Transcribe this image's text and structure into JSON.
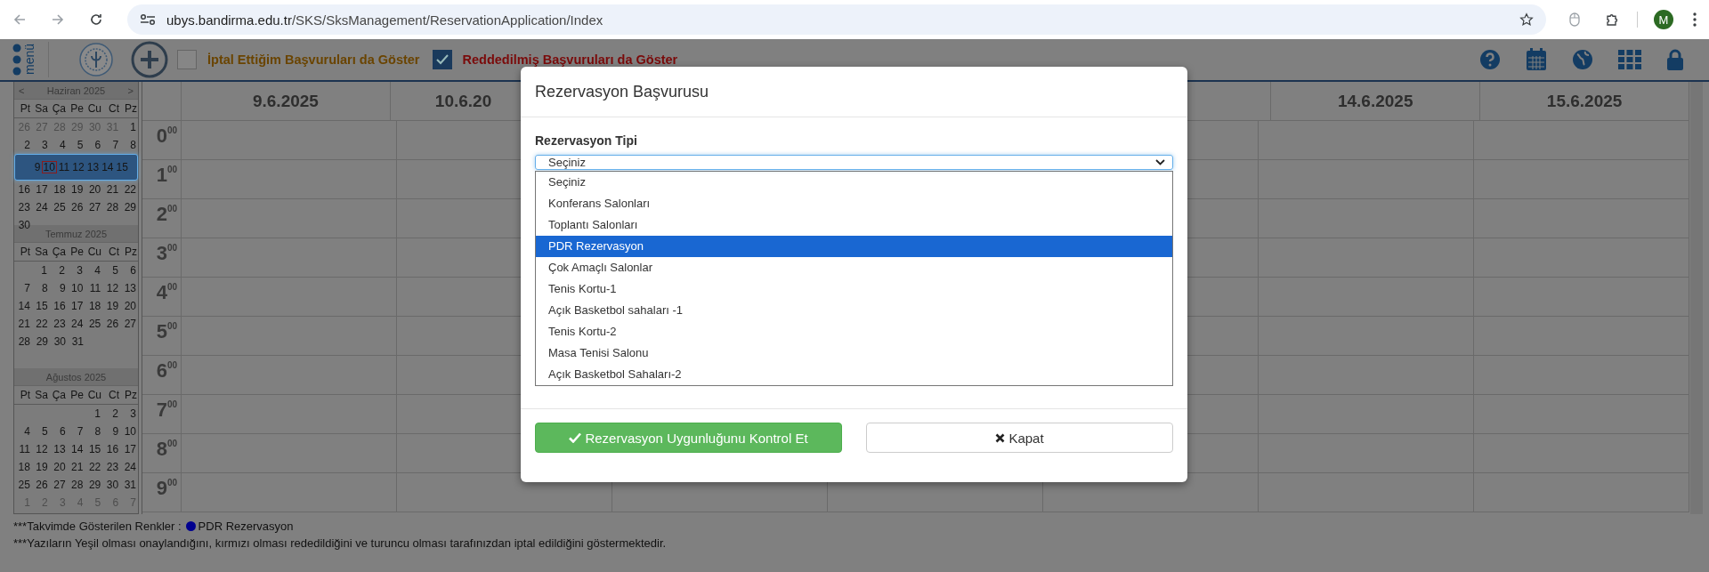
{
  "browser": {
    "url_host": "ubys.bandirma.edu.tr",
    "url_path": "/SKS/SksManagement/ReservationApplication/Index",
    "avatar": "M"
  },
  "toolbar": {
    "menu_label": "menü",
    "filters": [
      {
        "label": "İptal Ettiğim Başvuruları da Göster",
        "checked": false,
        "color": "#6a4400"
      },
      {
        "label": "Reddedilmiş Başvuruları da Göster",
        "checked": true,
        "color": "#7a0a0a"
      }
    ]
  },
  "mini_calendar": {
    "months": [
      {
        "title": "Haziran 2025",
        "prev": "<",
        "next": ">",
        "weekdays": [
          "Pt",
          "Sa",
          "Ça",
          "Pe",
          "Cu",
          "Ct",
          "Pz"
        ],
        "weeks": [
          {
            "kind": "full",
            "selected": false,
            "days": [
              {
                "day": "26",
                "muted": true,
                "today": false
              },
              {
                "day": "27",
                "muted": true,
                "today": false
              },
              {
                "day": "28",
                "muted": true,
                "today": false
              },
              {
                "day": "29",
                "muted": true,
                "today": false
              },
              {
                "day": "30",
                "muted": true,
                "today": false
              },
              {
                "day": "31",
                "muted": true,
                "today": false
              },
              {
                "day": "1",
                "muted": false,
                "today": false
              }
            ]
          },
          {
            "kind": "full",
            "selected": false,
            "days": [
              {
                "day": "2",
                "muted": false,
                "today": false
              },
              {
                "day": "3",
                "muted": false,
                "today": false
              },
              {
                "day": "4",
                "muted": false,
                "today": false
              },
              {
                "day": "5",
                "muted": false,
                "today": false
              },
              {
                "day": "6",
                "muted": false,
                "today": false
              },
              {
                "day": "7",
                "muted": false,
                "today": false
              },
              {
                "day": "8",
                "muted": false,
                "today": false
              }
            ]
          },
          {
            "kind": "full",
            "selected": true,
            "days": [
              {
                "day": "9",
                "muted": false,
                "today": false
              },
              {
                "day": "10",
                "muted": false,
                "today": true
              },
              {
                "day": "11",
                "muted": false,
                "today": false
              },
              {
                "day": "12",
                "muted": false,
                "today": false
              },
              {
                "day": "13",
                "muted": false,
                "today": false
              },
              {
                "day": "14",
                "muted": false,
                "today": false
              },
              {
                "day": "15",
                "muted": false,
                "today": false
              }
            ]
          },
          {
            "kind": "full",
            "selected": false,
            "days": [
              {
                "day": "16",
                "muted": false,
                "today": false
              },
              {
                "day": "17",
                "muted": false,
                "today": false
              },
              {
                "day": "18",
                "muted": false,
                "today": false
              },
              {
                "day": "19",
                "muted": false,
                "today": false
              },
              {
                "day": "20",
                "muted": false,
                "today": false
              },
              {
                "day": "21",
                "muted": false,
                "today": false
              },
              {
                "day": "22",
                "muted": false,
                "today": false
              }
            ]
          },
          {
            "kind": "full",
            "selected": false,
            "days": [
              {
                "day": "23",
                "muted": false,
                "today": false
              },
              {
                "day": "24",
                "muted": false,
                "today": false
              },
              {
                "day": "25",
                "muted": false,
                "today": false
              },
              {
                "day": "26",
                "muted": false,
                "today": false
              },
              {
                "day": "27",
                "muted": false,
                "today": false
              },
              {
                "day": "28",
                "muted": false,
                "today": false
              },
              {
                "day": "29",
                "muted": false,
                "today": false
              }
            ]
          },
          {
            "kind": "leading",
            "selected": false,
            "days": [
              {
                "day": "30",
                "muted": false,
                "today": false
              }
            ]
          }
        ]
      },
      {
        "title": "Temmuz 2025",
        "weekdays": [
          "Pt",
          "Sa",
          "Ça",
          "Pe",
          "Cu",
          "Ct",
          "Pz"
        ],
        "weeks": [
          {
            "kind": "trailing",
            "selected": false,
            "days": [
              {
                "day": "1",
                "muted": false,
                "today": false
              },
              {
                "day": "2",
                "muted": false,
                "today": false
              },
              {
                "day": "3",
                "muted": false,
                "today": false
              },
              {
                "day": "4",
                "muted": false,
                "today": false
              },
              {
                "day": "5",
                "muted": false,
                "today": false
              },
              {
                "day": "6",
                "muted": false,
                "today": false
              }
            ]
          },
          {
            "kind": "full",
            "selected": false,
            "days": [
              {
                "day": "7",
                "muted": false,
                "today": false
              },
              {
                "day": "8",
                "muted": false,
                "today": false
              },
              {
                "day": "9",
                "muted": false,
                "today": false
              },
              {
                "day": "10",
                "muted": false,
                "today": false
              },
              {
                "day": "11",
                "muted": false,
                "today": false
              },
              {
                "day": "12",
                "muted": false,
                "today": false
              },
              {
                "day": "13",
                "muted": false,
                "today": false
              }
            ]
          },
          {
            "kind": "full",
            "selected": false,
            "days": [
              {
                "day": "14",
                "muted": false,
                "today": false
              },
              {
                "day": "15",
                "muted": false,
                "today": false
              },
              {
                "day": "16",
                "muted": false,
                "today": false
              },
              {
                "day": "17",
                "muted": false,
                "today": false
              },
              {
                "day": "18",
                "muted": false,
                "today": false
              },
              {
                "day": "19",
                "muted": false,
                "today": false
              },
              {
                "day": "20",
                "muted": false,
                "today": false
              }
            ]
          },
          {
            "kind": "full",
            "selected": false,
            "days": [
              {
                "day": "21",
                "muted": false,
                "today": false
              },
              {
                "day": "22",
                "muted": false,
                "today": false
              },
              {
                "day": "23",
                "muted": false,
                "today": false
              },
              {
                "day": "24",
                "muted": false,
                "today": false
              },
              {
                "day": "25",
                "muted": false,
                "today": false
              },
              {
                "day": "26",
                "muted": false,
                "today": false
              },
              {
                "day": "27",
                "muted": false,
                "today": false
              }
            ]
          },
          {
            "kind": "leading",
            "selected": false,
            "days": [
              {
                "day": "28",
                "muted": false,
                "today": false
              },
              {
                "day": "29",
                "muted": false,
                "today": false
              },
              {
                "day": "30",
                "muted": false,
                "today": false
              },
              {
                "day": "31",
                "muted": false,
                "today": false
              }
            ]
          }
        ]
      },
      {
        "title": "Ağustos 2025",
        "weekdays": [
          "Pt",
          "Sa",
          "Ça",
          "Pe",
          "Cu",
          "Ct",
          "Pz"
        ],
        "weeks": [
          {
            "kind": "trailing",
            "selected": false,
            "days": [
              {
                "day": "1",
                "muted": false,
                "today": false
              },
              {
                "day": "2",
                "muted": false,
                "today": false
              },
              {
                "day": "3",
                "muted": false,
                "today": false
              }
            ]
          },
          {
            "kind": "full",
            "selected": false,
            "days": [
              {
                "day": "4",
                "muted": false,
                "today": false
              },
              {
                "day": "5",
                "muted": false,
                "today": false
              },
              {
                "day": "6",
                "muted": false,
                "today": false
              },
              {
                "day": "7",
                "muted": false,
                "today": false
              },
              {
                "day": "8",
                "muted": false,
                "today": false
              },
              {
                "day": "9",
                "muted": false,
                "today": false
              },
              {
                "day": "10",
                "muted": false,
                "today": false
              }
            ]
          },
          {
            "kind": "full",
            "selected": false,
            "days": [
              {
                "day": "11",
                "muted": false,
                "today": false
              },
              {
                "day": "12",
                "muted": false,
                "today": false
              },
              {
                "day": "13",
                "muted": false,
                "today": false
              },
              {
                "day": "14",
                "muted": false,
                "today": false
              },
              {
                "day": "15",
                "muted": false,
                "today": false
              },
              {
                "day": "16",
                "muted": false,
                "today": false
              },
              {
                "day": "17",
                "muted": false,
                "today": false
              }
            ]
          },
          {
            "kind": "full",
            "selected": false,
            "days": [
              {
                "day": "18",
                "muted": false,
                "today": false
              },
              {
                "day": "19",
                "muted": false,
                "today": false
              },
              {
                "day": "20",
                "muted": false,
                "today": false
              },
              {
                "day": "21",
                "muted": false,
                "today": false
              },
              {
                "day": "22",
                "muted": false,
                "today": false
              },
              {
                "day": "23",
                "muted": false,
                "today": false
              },
              {
                "day": "24",
                "muted": false,
                "today": false
              }
            ]
          },
          {
            "kind": "full",
            "selected": false,
            "days": [
              {
                "day": "25",
                "muted": false,
                "today": false
              },
              {
                "day": "26",
                "muted": false,
                "today": false
              },
              {
                "day": "27",
                "muted": false,
                "today": false
              },
              {
                "day": "28",
                "muted": false,
                "today": false
              },
              {
                "day": "29",
                "muted": false,
                "today": false
              },
              {
                "day": "30",
                "muted": false,
                "today": false
              },
              {
                "day": "31",
                "muted": false,
                "today": false
              }
            ]
          },
          {
            "kind": "full",
            "selected": false,
            "days": [
              {
                "day": "1",
                "muted": true,
                "today": false
              },
              {
                "day": "2",
                "muted": true,
                "today": false
              },
              {
                "day": "3",
                "muted": true,
                "today": false
              },
              {
                "day": "4",
                "muted": true,
                "today": false
              },
              {
                "day": "5",
                "muted": true,
                "today": false
              },
              {
                "day": "6",
                "muted": true,
                "today": false
              },
              {
                "day": "7",
                "muted": true,
                "today": false
              }
            ]
          }
        ]
      }
    ]
  },
  "schedule": {
    "days": [
      {
        "label": "9.6.2025",
        "kind": "full"
      },
      {
        "label": "10.6.20",
        "kind": "cut"
      },
      {
        "kind": "hidden"
      },
      {
        "kind": "hidden"
      },
      {
        "kind": "hidden"
      },
      {
        "label": "14.6.2025",
        "kind": "full"
      },
      {
        "label": "15.6.2025",
        "kind": "full"
      }
    ],
    "hours": [
      "0$^{00}$",
      "1$^{00}$",
      "2$^{00}$",
      "3$^{00}$",
      "4$^{00}$",
      "5$^{00}$",
      "6$^{00}$",
      "7$^{00}$",
      "8$^{00}$",
      "9$^{00}$"
    ]
  },
  "footer": {
    "legend_title": "***Takvimde Gösterilen Renkler :",
    "legend": [
      {
        "label": "PDR Rezervasyon",
        "color": "#00008f"
      }
    ],
    "note": "***Yazıların Yeşil olması onaylandığını, kırmızı olması rededildiğini ve turuncu olması tarafınızdan iptal edildiğini göstermektedir."
  },
  "modal": {
    "title": "Rezervasyon Başvurusu",
    "field_label": "Rezervasyon Tipi",
    "select_value": "Seçiniz",
    "options": [
      {
        "label": "Seçiniz",
        "selected": false
      },
      {
        "label": "Konferans Salonları",
        "selected": false
      },
      {
        "label": "Toplantı Salonları",
        "selected": false
      },
      {
        "label": "PDR Rezervasyon",
        "selected": true
      },
      {
        "label": "Çok Amaçlı Salonlar",
        "selected": false
      },
      {
        "label": "Tenis Kortu-1",
        "selected": false
      },
      {
        "label": "Açık Basketbol sahaları -1",
        "selected": false
      },
      {
        "label": "Tenis Kortu-2",
        "selected": false
      },
      {
        "label": "Masa Tenisi Salonu",
        "selected": false
      },
      {
        "label": "Açık Basketbol Sahaları-2",
        "selected": false
      }
    ],
    "buttons": [
      {
        "kind": "primary",
        "label": "Rezervasyon Uygunluğunu Kontrol Et"
      },
      {
        "kind": "secondary",
        "label": "Kapat"
      }
    ]
  }
}
